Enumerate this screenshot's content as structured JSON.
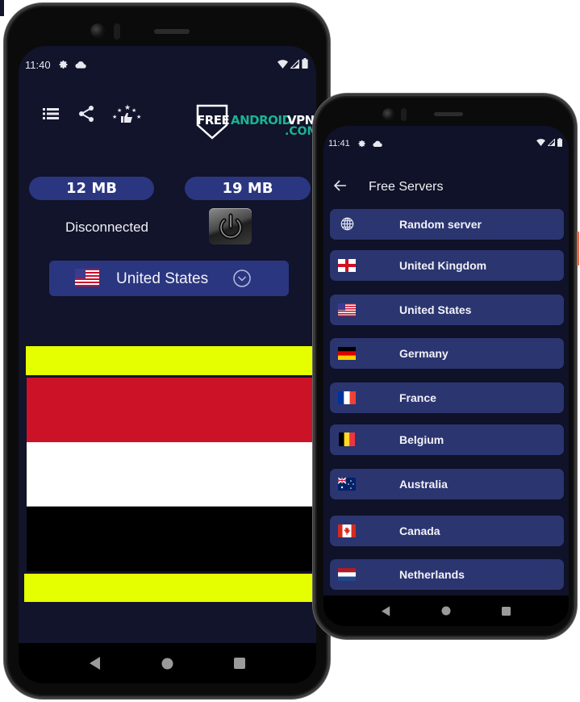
{
  "main_phone": {
    "status_bar": {
      "time": "11:40",
      "icons": [
        "settings-icon",
        "cloud-icon"
      ],
      "right_icons": [
        "wifi-icon",
        "signal-icon",
        "battery-icon"
      ]
    },
    "toolbar": {
      "icons": [
        "menu-list-icon",
        "share-icon",
        "rate-app-icon"
      ]
    },
    "logo": {
      "free": "FREE",
      "android": "ANDROID",
      "vpn": "VPN",
      "com": ".COM"
    },
    "stats": {
      "download": "12 MB",
      "upload": "19 MB"
    },
    "connection_status": "Disconnected",
    "power_button": {
      "icon": "power-icon"
    },
    "selected_country": {
      "flag": "🇺🇸",
      "name": "United States",
      "icon": "chevron-down-circle-icon"
    },
    "banner_colors": [
      "#e6ff00",
      "#cc1227",
      "#ffffff",
      "#000000",
      "#e6ff00"
    ],
    "nav": [
      "back",
      "home",
      "recents"
    ]
  },
  "servers_phone": {
    "status_bar": {
      "time": "11:41",
      "icons": [
        "settings-icon",
        "cloud-icon"
      ],
      "right_icons": [
        "wifi-icon",
        "signal-icon",
        "battery-icon"
      ]
    },
    "header": {
      "title": "Free Servers",
      "back_icon": "arrow-left-icon"
    },
    "servers": [
      {
        "name": "Random server",
        "flag": "globe"
      },
      {
        "name": "United Kingdom",
        "flag": "🏴"
      },
      {
        "name": "United States",
        "flag": "🇺🇸"
      },
      {
        "name": "Germany",
        "flag": "🇩🇪"
      },
      {
        "name": "France",
        "flag": "🇫🇷"
      },
      {
        "name": "Belgium",
        "flag": "🇧🇪"
      },
      {
        "name": "Australia",
        "flag": "🇦🇺"
      },
      {
        "name": "Canada",
        "flag": "🇨🇦"
      },
      {
        "name": "Netherlands",
        "flag": "🇳🇱"
      }
    ],
    "nav": [
      "back",
      "home",
      "recents"
    ]
  },
  "colors": {
    "screen_bg": "#11142a",
    "pill_bg": "#2b3680",
    "list_item_bg": "#2b3570",
    "logo_accent": "#1ab394"
  }
}
